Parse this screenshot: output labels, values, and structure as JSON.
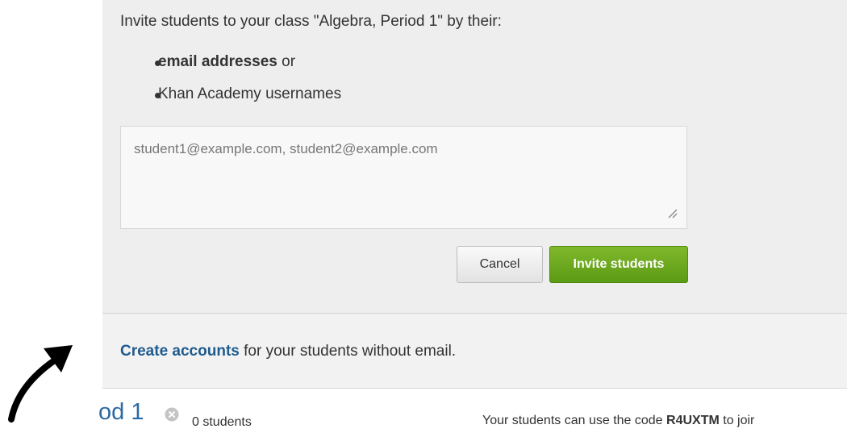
{
  "invite": {
    "intro": "Invite students to your class \"Algebra, Period 1\" by their:",
    "methods": [
      {
        "bold": "email addresses",
        "rest": " or"
      },
      {
        "bold": "",
        "rest": "Khan Academy usernames"
      }
    ],
    "textarea_value": "student1@example.com, student2@example.com",
    "cancel_label": "Cancel",
    "invite_label": "Invite students"
  },
  "create": {
    "link": "Create accounts",
    "rest": " for your students without email."
  },
  "class_row": {
    "name": "od 1",
    "student_count": "0 students",
    "code_prefix": "Your students can use the code ",
    "code": "R4UXTM",
    "code_suffix": " to joir"
  },
  "icons": {
    "resize": "resize-grip-icon",
    "remove": "remove-circle-icon",
    "arrow": "curved-arrow-icon"
  },
  "colors": {
    "invite_button": "#6aaa1e",
    "link": "#1f5b8f",
    "class_name": "#2b6aa3",
    "panel_bg": "#eeeeee"
  }
}
